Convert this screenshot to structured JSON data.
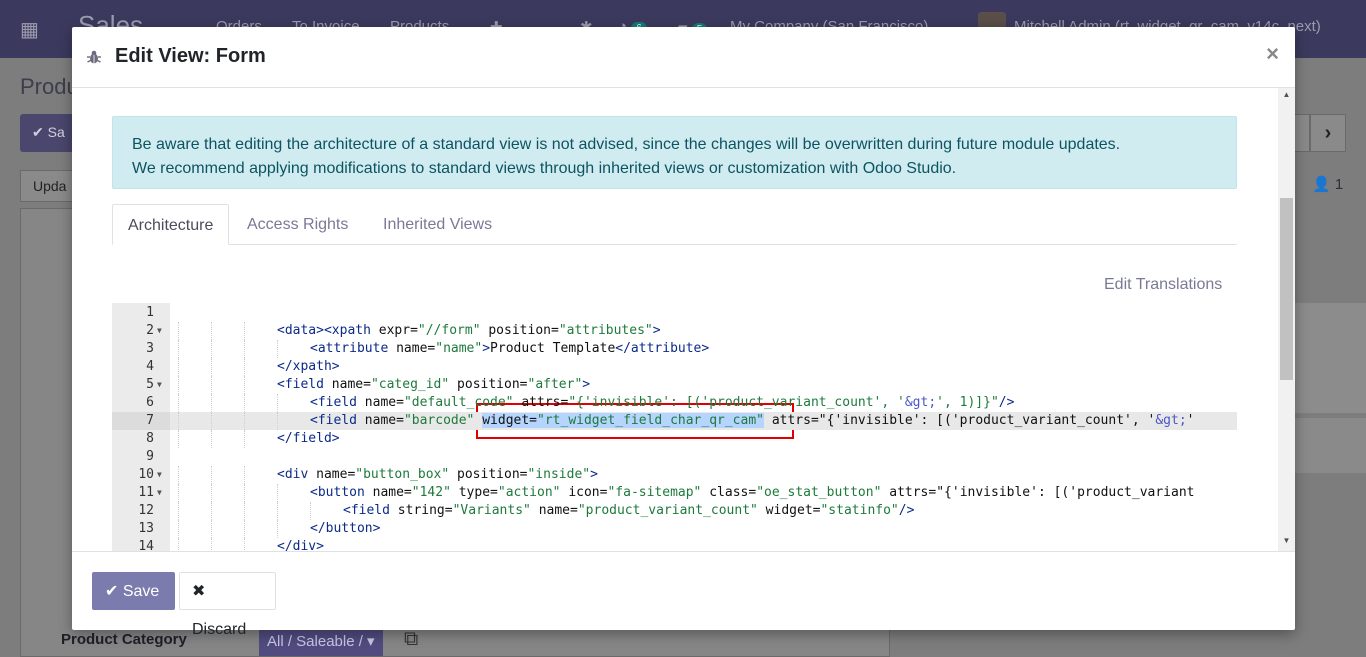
{
  "background": {
    "brand": "Sales",
    "menu": [
      "Orders",
      "To Invoice",
      "Products"
    ],
    "activity_badge": "6",
    "message_badge": "5",
    "company": "My Company (San Francisco)",
    "user": "Mitchell Admin (rt_widget_qr_cam_v14c_next)",
    "page_title": "Produ",
    "save_label": "Sa",
    "update_label": "Upda",
    "follower_count": "1",
    "product_category_label": "Product Category",
    "product_category_value": "All / Saleable /"
  },
  "modal": {
    "title": "Edit View: Form",
    "close": "×",
    "alert_line1": "Be aware that editing the architecture of a standard view is not advised, since the changes will be overwritten during future module updates.",
    "alert_line2": "We recommend applying modifications to standard views through inherited views or customization with Odoo Studio.",
    "tabs": [
      {
        "label": "Architecture",
        "active": true
      },
      {
        "label": "Access Rights",
        "active": false
      },
      {
        "label": "Inherited Views",
        "active": false
      }
    ],
    "edit_translations": "Edit Translations",
    "code_lines": [
      {
        "n": "1",
        "fold": false,
        "indent": 0,
        "text": ""
      },
      {
        "n": "2",
        "fold": true,
        "indent": 3,
        "text": "<data><xpath expr=\"//form\" position=\"attributes\">"
      },
      {
        "n": "3",
        "fold": false,
        "indent": 4,
        "text": "<attribute name=\"name\">Product Template</attribute>"
      },
      {
        "n": "4",
        "fold": false,
        "indent": 3,
        "text": "</xpath>"
      },
      {
        "n": "5",
        "fold": true,
        "indent": 3,
        "text": "<field name=\"categ_id\" position=\"after\">"
      },
      {
        "n": "6",
        "fold": false,
        "indent": 4,
        "text": "<field name=\"default_code\" attrs=\"{'invisible': [('product_variant_count', '&gt;', 1)]}\"/>"
      },
      {
        "n": "7",
        "fold": false,
        "indent": 4,
        "text": "<field name=\"barcode\" widget=\"rt_widget_field_char_qr_cam\" attrs=\"{'invisible': [('product_variant_count', '&gt;'"
      },
      {
        "n": "8",
        "fold": false,
        "indent": 3,
        "text": "</field>"
      },
      {
        "n": "9",
        "fold": false,
        "indent": 0,
        "text": ""
      },
      {
        "n": "10",
        "fold": true,
        "indent": 3,
        "text": "<div name=\"button_box\" position=\"inside\">"
      },
      {
        "n": "11",
        "fold": true,
        "indent": 4,
        "text": "<button name=\"142\" type=\"action\" icon=\"fa-sitemap\" class=\"oe_stat_button\" attrs=\"{'invisible': [('product_variant"
      },
      {
        "n": "12",
        "fold": false,
        "indent": 5,
        "text": "<field string=\"Variants\" name=\"product_variant_count\" widget=\"statinfo\"/>"
      },
      {
        "n": "13",
        "fold": false,
        "indent": 4,
        "text": "</button>"
      },
      {
        "n": "14",
        "fold": false,
        "indent": 3,
        "text": "</div>"
      }
    ],
    "active_line": "7",
    "selected_text": "widget=\"rt_widget_field_char_qr_cam\"",
    "save_label": "Save",
    "discard_label": "Discard"
  }
}
